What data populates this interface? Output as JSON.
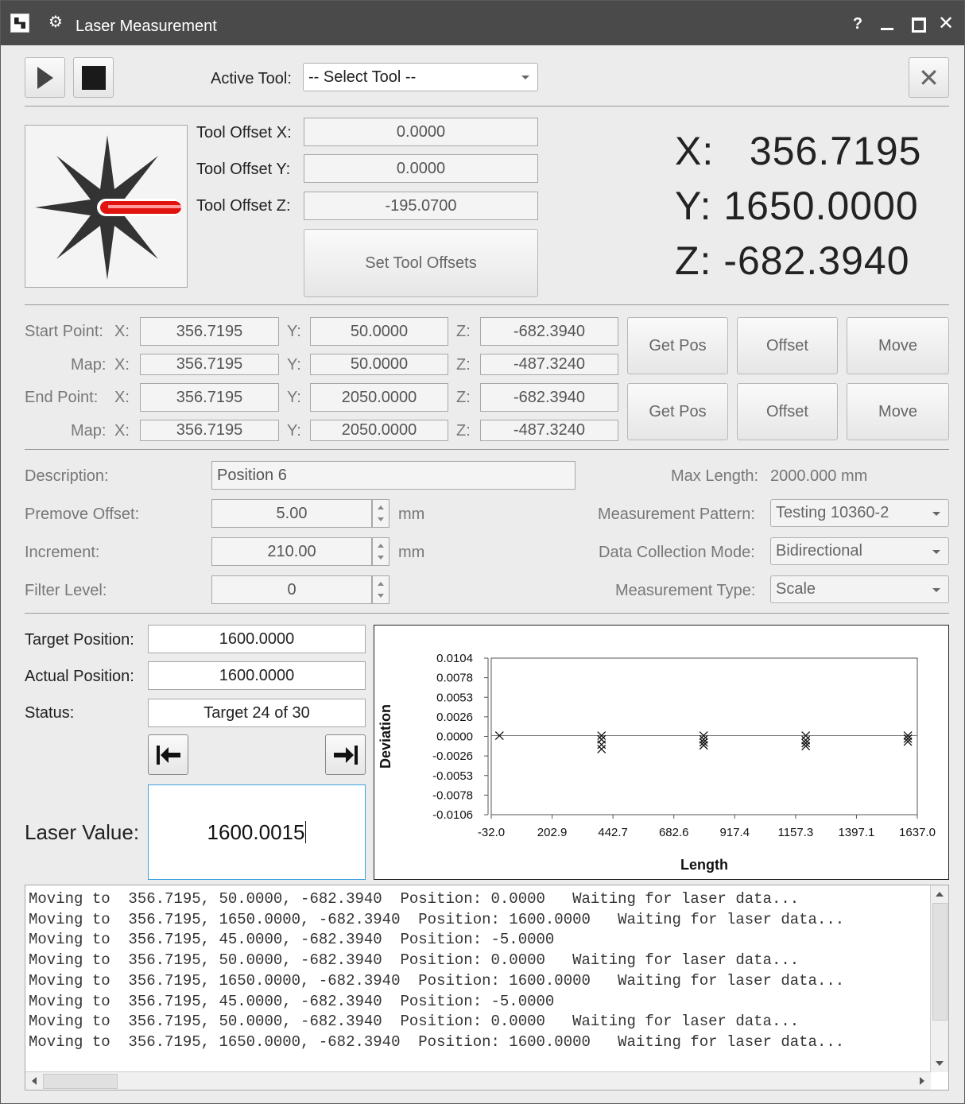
{
  "window": {
    "title": "Laser Measurement",
    "help": "?",
    "minimize": "_"
  },
  "toolbar": {
    "active_tool_label": "Active Tool:",
    "active_tool_value": "-- Select Tool --"
  },
  "offsets": {
    "x_label": "Tool Offset X:",
    "x_value": "0.0000",
    "y_label": "Tool Offset Y:",
    "y_value": "0.0000",
    "z_label": "Tool Offset Z:",
    "z_value": "-195.0700",
    "set_button": "Set Tool Offsets"
  },
  "readout": {
    "x": "X:   356.7195",
    "y": "Y: 1650.0000",
    "z": "Z: -682.3940"
  },
  "points": {
    "x": "X:",
    "y": "Y:",
    "z": "Z:",
    "start_label": "Start Point:",
    "map_label": "Map:",
    "end_label": "End Point:",
    "start": {
      "x": "356.7195",
      "y": "50.0000",
      "z": "-682.3940"
    },
    "start_map": {
      "x": "356.7195",
      "y": "50.0000",
      "z": "-487.3240"
    },
    "end": {
      "x": "356.7195",
      "y": "2050.0000",
      "z": "-682.3940"
    },
    "end_map": {
      "x": "356.7195",
      "y": "2050.0000",
      "z": "-487.3240"
    },
    "get_pos": "Get Pos",
    "offset": "Offset",
    "move": "Move"
  },
  "settings": {
    "description_label": "Description:",
    "description_value": "Position 6",
    "premove_label": "Premove Offset:",
    "premove_value": "5.00",
    "increment_label": "Increment:",
    "increment_value": "210.00",
    "filter_label": "Filter Level:",
    "filter_value": "0",
    "unit": "mm",
    "max_length_label": "Max Length:",
    "max_length_value": "2000.000 mm",
    "pattern_label": "Measurement Pattern:",
    "pattern_value": "Testing 10360-2",
    "mode_label": "Data Collection Mode:",
    "mode_value": "Bidirectional",
    "type_label": "Measurement Type:",
    "type_value": "Scale"
  },
  "status": {
    "target_label": "Target Position:",
    "target_value": "1600.0000",
    "actual_label": "Actual Position:",
    "actual_value": "1600.0000",
    "status_label": "Status:",
    "status_value": "Target 24 of 30",
    "laser_label": "Laser Value:",
    "laser_value": "1600.0015"
  },
  "chart_data": {
    "type": "scatter",
    "title": "",
    "xlabel": "Length",
    "ylabel": "Deviation",
    "xlim": [
      -32.0,
      1637.0
    ],
    "ylim": [
      -0.0106,
      0.0104
    ],
    "x_ticks": [
      "-32.0",
      "202.9",
      "442.7",
      "682.6",
      "917.4",
      "1157.3",
      "1397.1",
      "1637.0"
    ],
    "y_ticks": [
      "0.0104",
      "0.0078",
      "0.0053",
      "0.0026",
      "0.0000",
      "-0.0026",
      "-0.0053",
      "-0.0078",
      "-0.0106"
    ],
    "marker": "x",
    "grid": false,
    "points": [
      {
        "x": 0,
        "y": 0.0
      },
      {
        "x": 400,
        "y": 0.0
      },
      {
        "x": 400,
        "y": -0.0005
      },
      {
        "x": 400,
        "y": -0.0012
      },
      {
        "x": 400,
        "y": -0.0018
      },
      {
        "x": 800,
        "y": 0.0
      },
      {
        "x": 800,
        "y": -0.0005
      },
      {
        "x": 800,
        "y": -0.0009
      },
      {
        "x": 800,
        "y": -0.0013
      },
      {
        "x": 1200,
        "y": 0.0
      },
      {
        "x": 1200,
        "y": -0.0006
      },
      {
        "x": 1200,
        "y": -0.001
      },
      {
        "x": 1200,
        "y": -0.0014
      },
      {
        "x": 1600,
        "y": 0.0
      },
      {
        "x": 1600,
        "y": -0.0004
      },
      {
        "x": 1600,
        "y": -0.0008
      }
    ]
  },
  "log": [
    "Moving to  356.7195, 50.0000, -682.3940  Position: 0.0000   Waiting for laser data...",
    "Moving to  356.7195, 1650.0000, -682.3940  Position: 1600.0000   Waiting for laser data...",
    "Moving to  356.7195, 45.0000, -682.3940  Position: -5.0000",
    "Moving to  356.7195, 50.0000, -682.3940  Position: 0.0000   Waiting for laser data...",
    "Moving to  356.7195, 1650.0000, -682.3940  Position: 1600.0000   Waiting for laser data...",
    "Moving to  356.7195, 45.0000, -682.3940  Position: -5.0000",
    "Moving to  356.7195, 50.0000, -682.3940  Position: 0.0000   Waiting for laser data...",
    "Moving to  356.7195, 1650.0000, -682.3940  Position: 1600.0000   Waiting for laser data..."
  ]
}
